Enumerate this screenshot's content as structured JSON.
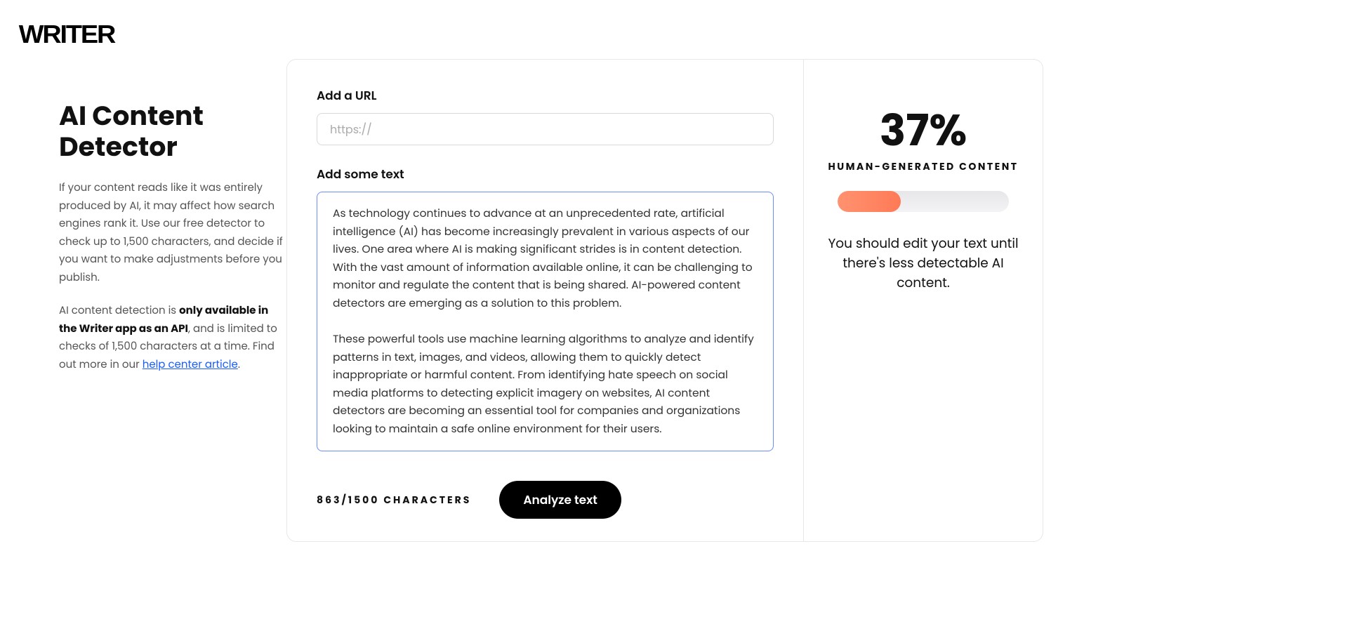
{
  "logo": "WRITER",
  "sidebar": {
    "title": "AI Content Detector",
    "p1": "If your content reads like it was entirely produced by AI, it may affect how search engines rank it. Use our free detector to check up to 1,500 characters, and decide if you want to make adjustments before you publish.",
    "p2_pre": "AI content detection is ",
    "p2_strong": "only available in the Writer app as an API",
    "p2_post": ", and is limited to checks of 1,500 characters at a time. Find out more in our ",
    "p2_link": "help center article",
    "p2_tail": "."
  },
  "input": {
    "url_label": "Add a URL",
    "url_placeholder": "https://",
    "text_label": "Add some text",
    "text_value": "As technology continues to advance at an unprecedented rate, artificial intelligence (AI) has become increasingly prevalent in various aspects of our lives. One area where AI is making significant strides is in content detection. With the vast amount of information available online, it can be challenging to monitor and regulate the content that is being shared. AI-powered content detectors are emerging as a solution to this problem.\n\nThese powerful tools use machine learning algorithms to analyze and identify patterns in text, images, and videos, allowing them to quickly detect inappropriate or harmful content. From identifying hate speech on social media platforms to detecting explicit imagery on websites, AI content detectors are becoming an essential tool for companies and organizations looking to maintain a safe online environment for their users.",
    "char_count": "863/1500 CHARACTERS",
    "analyze_btn": "Analyze text"
  },
  "result": {
    "percent": "37%",
    "percent_value": 37,
    "label": "HUMAN-GENERATED CONTENT",
    "message": "You should edit your text until there's less detectable AI content."
  },
  "chart_data": {
    "type": "bar",
    "title": "Human-generated content",
    "categories": [
      "Human-generated"
    ],
    "values": [
      37
    ],
    "ylim": [
      0,
      100
    ],
    "xlabel": "",
    "ylabel": "percent"
  }
}
